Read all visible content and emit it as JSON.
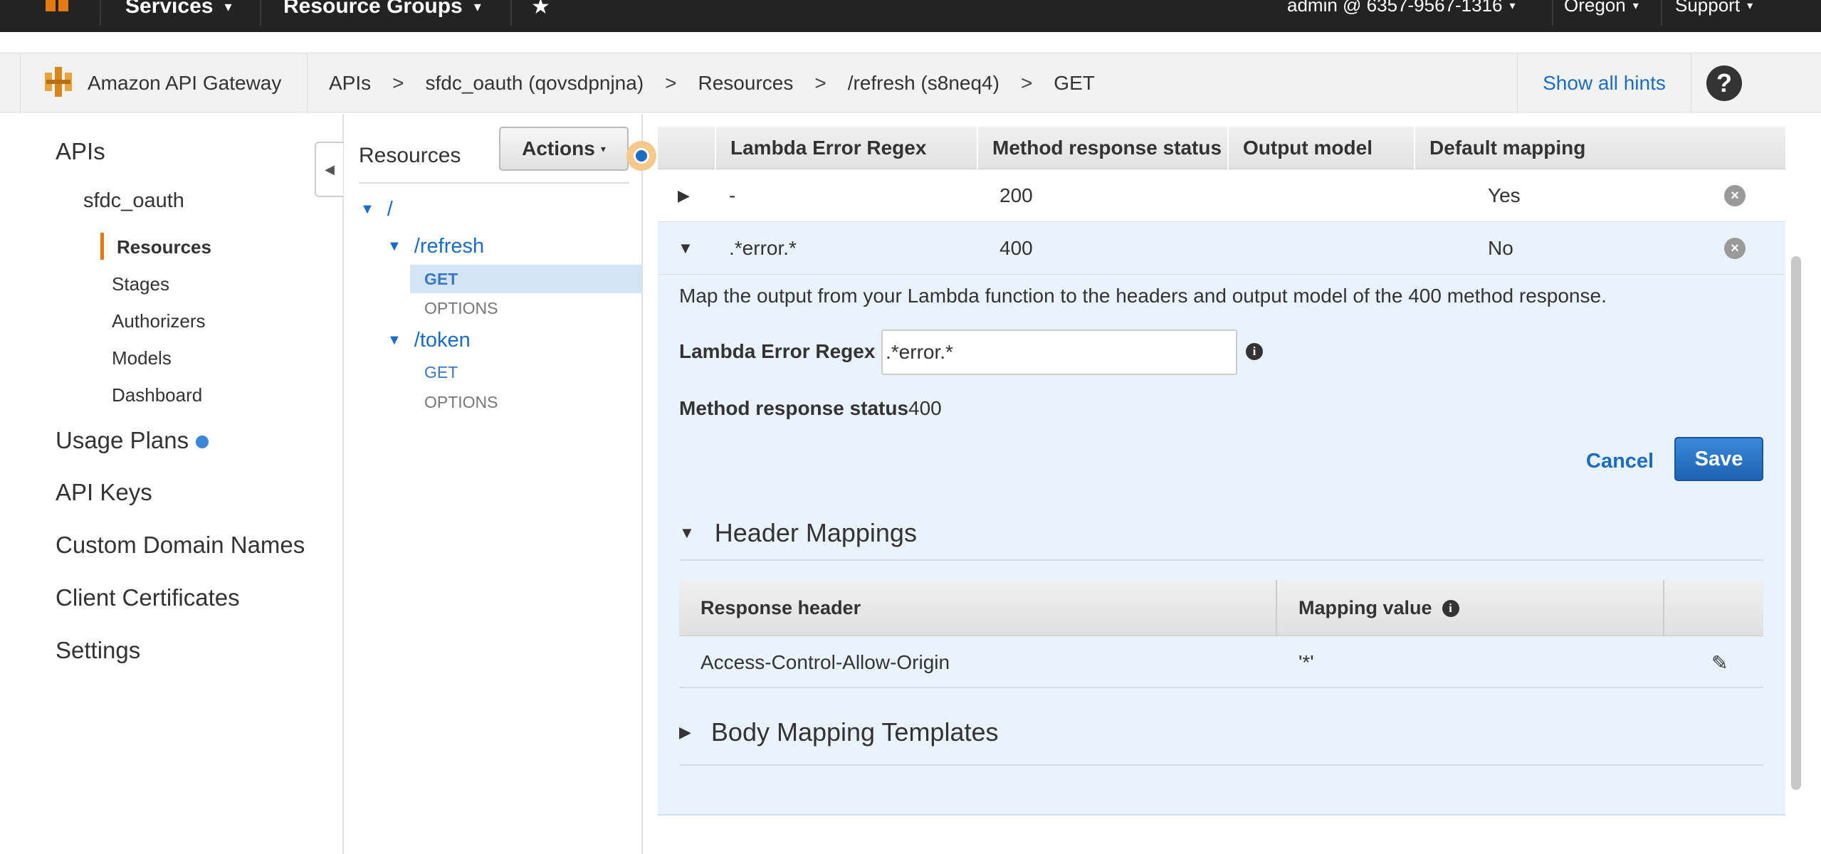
{
  "topbar": {
    "services_label": "Services",
    "resource_groups_label": "Resource Groups",
    "account_label": "admin @ 6357-9567-1316",
    "region_label": "Oregon",
    "support_label": "Support",
    "caret": "▾",
    "star": "★"
  },
  "servicebar": {
    "service_name": "Amazon API Gateway",
    "breadcrumbs": [
      "APIs",
      "sfdc_oauth (qovsdpnjna)",
      "Resources",
      "/refresh (s8neq4)",
      "GET"
    ],
    "separator": ">",
    "show_hints_label": "Show all hints",
    "help_label": "?"
  },
  "sidebar": {
    "apis_label": "APIs",
    "api_name": "sfdc_oauth",
    "children": [
      "Resources",
      "Stages",
      "Authorizers",
      "Models",
      "Dashboard"
    ],
    "items": [
      "Usage Plans",
      "API Keys",
      "Custom Domain Names",
      "Client Certificates",
      "Settings"
    ],
    "collapse_glyph": "◀"
  },
  "resources_panel": {
    "title": "Resources",
    "actions_label": "Actions",
    "tree": {
      "root": "/",
      "refresh": "/refresh",
      "refresh_get": "GET",
      "refresh_options": "OPTIONS",
      "token": "/token",
      "token_get": "GET",
      "token_options": "OPTIONS"
    }
  },
  "response_table": {
    "headers": [
      "Lambda Error Regex",
      "Method response status",
      "Output model",
      "Default mapping"
    ],
    "rows": [
      {
        "regex": "-",
        "status": "200",
        "model": "",
        "default": "Yes"
      },
      {
        "regex": ".*error.*",
        "status": "400",
        "model": "",
        "default": "No"
      }
    ]
  },
  "detail": {
    "description": "Map the output from your Lambda function to the headers and output model of the 400 method response.",
    "regex_label": "Lambda Error Regex",
    "regex_value": ".*error.*",
    "status_label": "Method response status",
    "status_value": "400",
    "cancel_label": "Cancel",
    "save_label": "Save",
    "info_glyph": "i"
  },
  "header_mappings": {
    "title": "Header Mappings",
    "headers": [
      "Response header",
      "Mapping value"
    ],
    "rows": [
      {
        "header": "Access-Control-Allow-Origin",
        "value": "'*'"
      }
    ]
  },
  "body_mapping": {
    "title": "Body Mapping Templates"
  },
  "colors": {
    "accent": "#1a6cc4",
    "active_marker": "#e47911",
    "expanded_bg": "#eaf3fc"
  }
}
